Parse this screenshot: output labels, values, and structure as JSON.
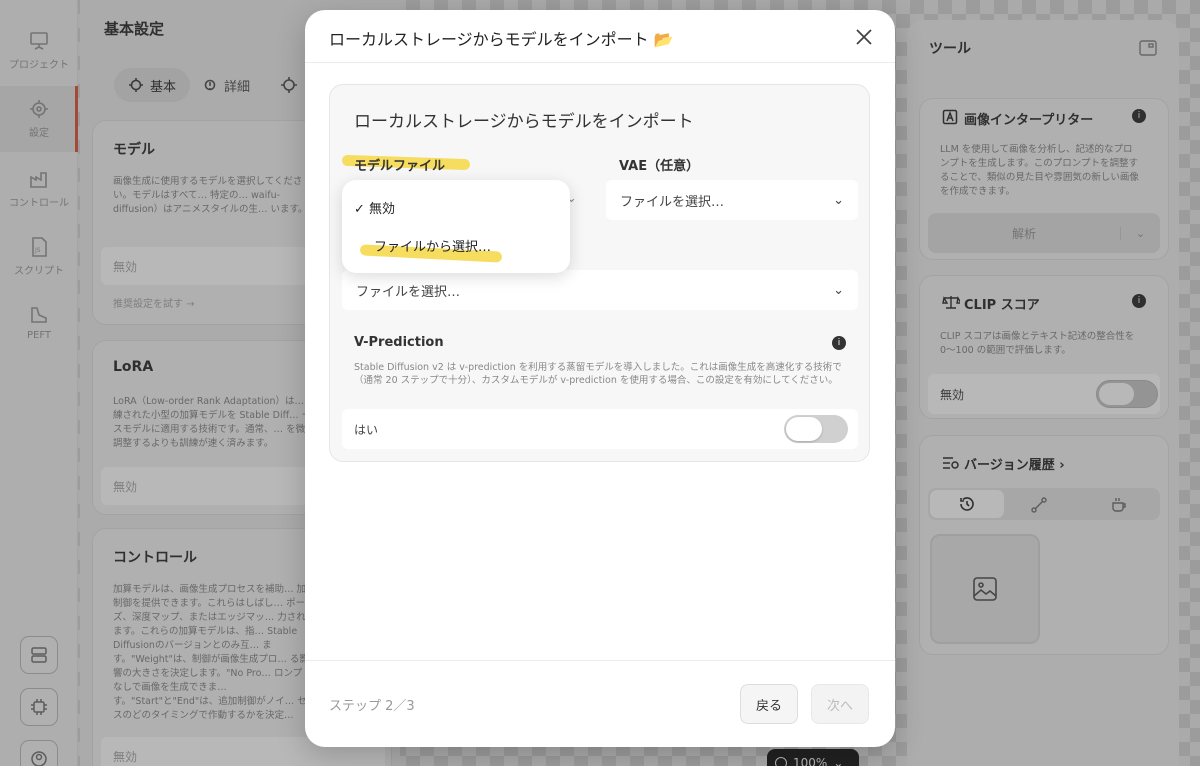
{
  "rail": {
    "items": [
      {
        "label": "プロジェクト",
        "icon": "presentation-icon"
      },
      {
        "label": "設定",
        "icon": "settings-gear-icon"
      },
      {
        "label": "コントロール",
        "icon": "factory-icon"
      },
      {
        "label": "スクリプト",
        "icon": "js-file-icon"
      },
      {
        "label": "PEFT",
        "icon": "shoe-icon"
      }
    ]
  },
  "settings": {
    "title": "基本設定",
    "tabs": [
      "基本",
      "詳細"
    ],
    "model": {
      "title": "モデル",
      "desc": "画像生成に使用するモデルを選択してください。モデルはすべて… 特定の… waifu-diffusion）はアニメスタイルの生… います。",
      "value": "無効",
      "link": "推奨設定を試す →"
    },
    "lora": {
      "title": "LoRA",
      "desc": "LoRA（Low-order Rank Adaptation）は… 練された小型の加算モデルを Stable Diff… ースモデルに適用する技術です。通常、… を微調整するよりも訓練が速く済みます。",
      "value": "無効"
    },
    "control": {
      "title": "コントロール",
      "desc": "加算モデルは、画像生成プロセスを補助… 加制御を提供できます。これらはしばし… ポーズ、深度マップ、またはエッジマッ… 力されます。これらの加算モデルは、指… Stable Diffusionのバージョンとのみ互… ます。\"Weight\"は、制御が画像生成プロ… る影響の大きさを決定します。\"No Pro… ロンプトなしで画像を生成できま… す。\"Start\"と\"End\"は、追加制御がノイ… セスのどのタイミングで作動するかを決定…",
      "value": "無効"
    }
  },
  "tools": {
    "title": "ツール",
    "interpreter": {
      "title": "画像インタープリター",
      "desc": "LLM を使用して画像を分析し、記述的なプロンプトを生成します。このプロンプトを調整することで、類似の見た目や雰囲気の新しい画像を作成できます。",
      "button": "解析"
    },
    "clip": {
      "title": "CLIP スコア",
      "desc": "CLIP スコアは画像とテキスト記述の整合性を 0〜100 の範囲で評価します。",
      "label": "無効"
    },
    "history": {
      "title": "バージョン履歴 ›"
    }
  },
  "zoom": "100%",
  "modal": {
    "title": "ローカルストレージからモデルをインポート 📂",
    "heading": "ローカルストレージからモデルをインポート",
    "model_file_label": "モデルファイル",
    "vae_label": "VAE（任意）",
    "vae_value": "ファイルを選択…",
    "file_select": "ファイルを選択…",
    "dropdown": {
      "options": [
        "✓ 無効",
        "ファイルから選択…"
      ]
    },
    "vpred": {
      "title": "V-Prediction",
      "desc": "Stable Diffusion v2 は v-prediction を利用する蒸留モデルを導入しました。これは画像生成を高速化する技術で（通常 20 ステップで十分）、カスタムモデルが v-prediction を使用する場合、この設定を有効にしてください。",
      "toggle_label": "はい",
      "toggle_on": false
    },
    "step": "ステップ 2／3",
    "back": "戻る",
    "next": "次へ"
  }
}
